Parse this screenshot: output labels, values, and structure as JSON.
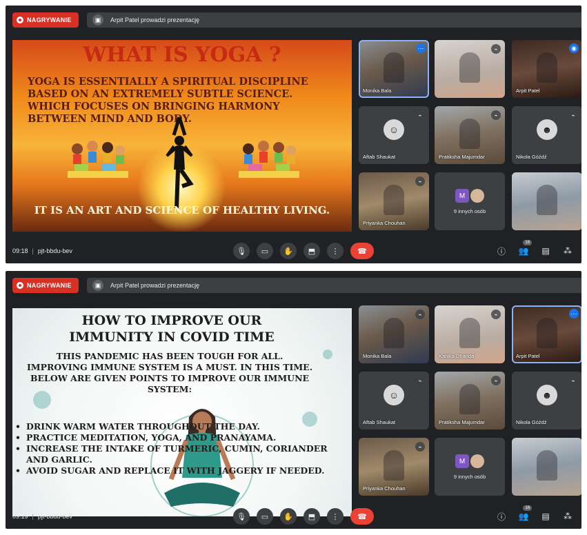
{
  "recording_label": "NAGRYWANIE",
  "presenting_text": "Arpit Patel prowadzi prezentację",
  "meetings": [
    {
      "time": "09:18",
      "code": "pjt-bbdu-bev",
      "slide": {
        "title": "WHAT IS YOGA ?",
        "body": "YOGA IS ESSENTIALLY A SPIRITUAL DISCIPLINE BASED ON AN EXTREMELY SUBTLE SCIENCE. WHICH FOCUSES ON BRINGING HARMONY BETWEEN MIND AND BODY.",
        "footer": "IT IS AN ART AND SCIENCE OF HEALTHY LIVING."
      },
      "tiles": [
        "Monika Bala",
        "",
        "Arpit Patel",
        "Aftab Shaukat",
        "Pratiksha Majumdar",
        "Nikola Góźdź",
        "Priyanka Chouhan",
        "",
        ""
      ],
      "others_label": "9 innych osób"
    },
    {
      "time": "09:19",
      "code": "pjt-bbdu-bev",
      "slide": {
        "title": "HOW TO IMPROVE OUR IMMUNITY IN COVID TIME",
        "intro": "THIS PANDEMIC HAS BEEN TOUGH FOR ALL. IMPROVING IMMUNE SYSTEM IS A MUST. IN THIS TIME. BELOW ARE GIVEN POINTS TO IMPROVE OUR IMMUNE SYSTEM:",
        "bullets": [
          "DRINK WARM WATER THROUGHOUT THE DAY.",
          "PRACTICE MEDITATION, YOGA, AND PRANAYAMA.",
          "INCREASE THE INTAKE OF TURMERIC, CUMIN, CORIANDER AND GARLIC.",
          "AVOID SUGAR AND REPLACE IT WITH JAGGERY IF NEEDED."
        ]
      },
      "tiles": [
        "Monika Bala",
        "Kanika Dhanda",
        "Arpit Patel",
        "Aftab Shaukat",
        "Pratiksha Majumdar",
        "Nikola Góźdź",
        "Priyanka Chouhan",
        "",
        ""
      ],
      "others_label": "9 innych osób"
    }
  ],
  "participants_count": "18",
  "colors": {
    "end_call": "#ea4335",
    "recording": "#d93025",
    "active_outline": "#8ab4f8"
  },
  "icons": [
    "mic-icon",
    "camera-icon",
    "raise-hand-icon",
    "present-icon",
    "more-icon",
    "end-call-icon",
    "info-icon",
    "people-icon",
    "chat-icon",
    "activities-icon"
  ]
}
